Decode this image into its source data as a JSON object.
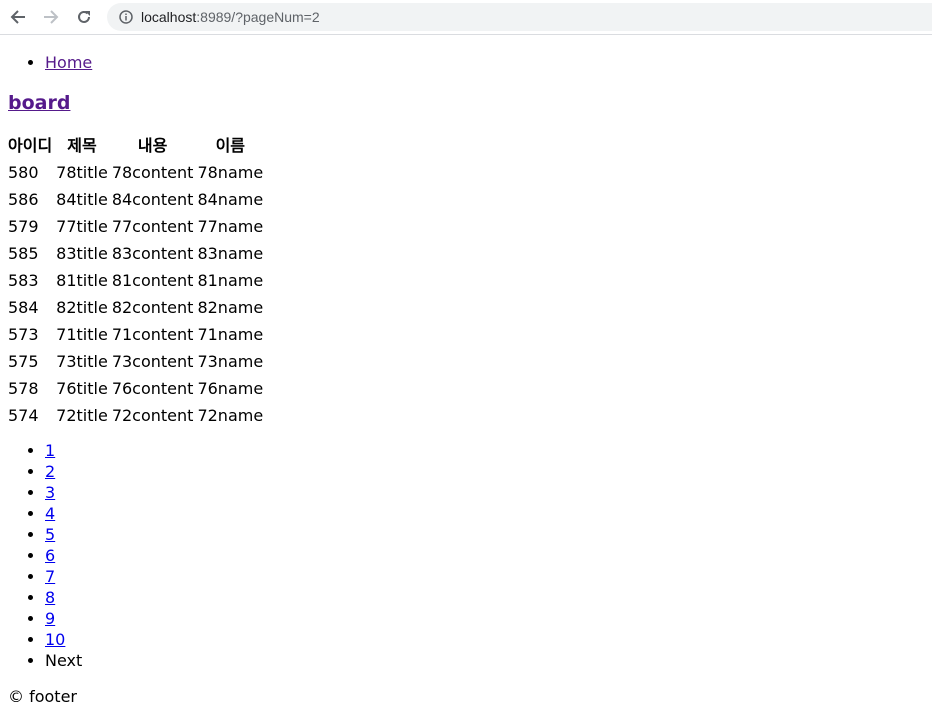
{
  "browser": {
    "url_host": "localhost",
    "url_rest": ":8989/?pageNum=2"
  },
  "nav": {
    "home_label": "Home"
  },
  "title": "board",
  "table": {
    "headers": [
      "아이디",
      "제목",
      "내용",
      "이름"
    ],
    "rows": [
      [
        "580",
        "78title",
        "78content",
        "78name"
      ],
      [
        "586",
        "84title",
        "84content",
        "84name"
      ],
      [
        "579",
        "77title",
        "77content",
        "77name"
      ],
      [
        "585",
        "83title",
        "83content",
        "83name"
      ],
      [
        "583",
        "81title",
        "81content",
        "81name"
      ],
      [
        "584",
        "82title",
        "82content",
        "82name"
      ],
      [
        "573",
        "71title",
        "71content",
        "71name"
      ],
      [
        "575",
        "73title",
        "73content",
        "73name"
      ],
      [
        "578",
        "76title",
        "76content",
        "76name"
      ],
      [
        "574",
        "72title",
        "72content",
        "72name"
      ]
    ]
  },
  "pagination": {
    "pages": [
      "1",
      "2",
      "3",
      "4",
      "5",
      "6",
      "7",
      "8",
      "9",
      "10"
    ],
    "next_label": "Next"
  },
  "footer": {
    "text": "© footer"
  }
}
